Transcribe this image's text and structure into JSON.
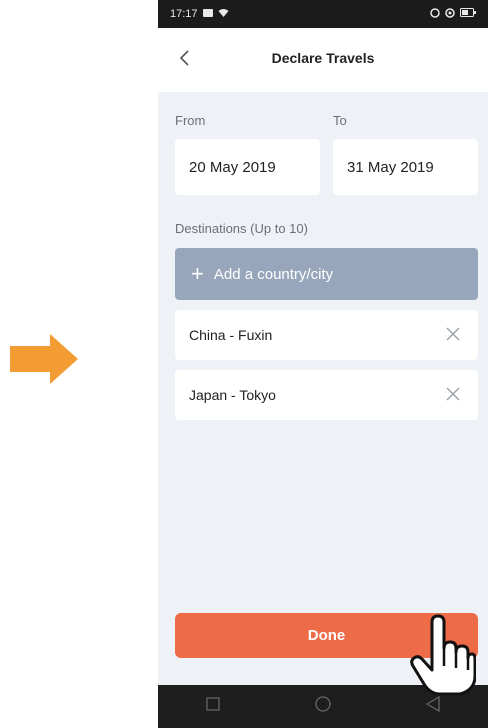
{
  "status_bar": {
    "time": "17:17"
  },
  "header": {
    "title": "Declare Travels",
    "back_icon": "chevron-left-icon"
  },
  "dates": {
    "from_label": "From",
    "to_label": "To",
    "from_value": "20 May 2019",
    "to_value": "31 May 2019"
  },
  "destinations": {
    "label": "Destinations (Up to 10)",
    "add_label": "Add a country/city",
    "items": [
      {
        "name": "China - Fuxin"
      },
      {
        "name": "Japan - Tokyo"
      }
    ]
  },
  "footer": {
    "done_label": "Done"
  },
  "colors": {
    "accent": "#ee6b47",
    "add_button": "#97a6bb",
    "background": "#eef1f5",
    "pointer_arrow": "#f39c33"
  },
  "icons": [
    "arrow-right-icon",
    "chevron-left-icon",
    "plus-icon",
    "close-icon",
    "pointing-hand-icon",
    "square-icon",
    "circle-icon",
    "triangle-back-icon"
  ]
}
